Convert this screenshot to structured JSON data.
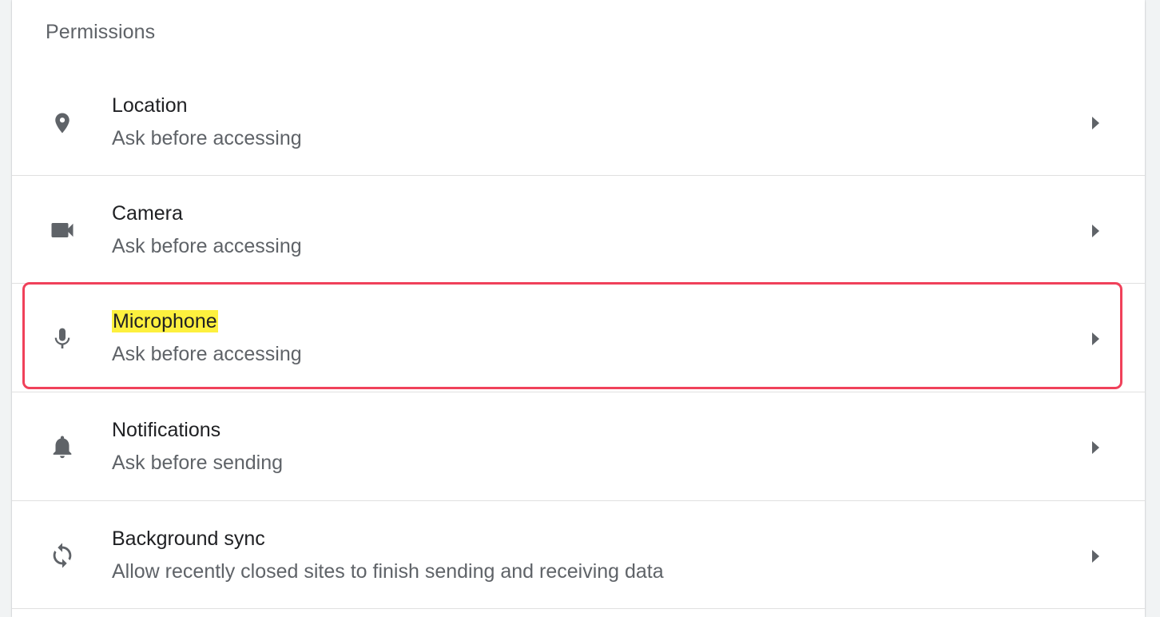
{
  "section": {
    "title": "Permissions"
  },
  "rows": [
    {
      "title": "Location",
      "subtitle": "Ask before accessing",
      "icon": "location-pin-icon"
    },
    {
      "title": "Camera",
      "subtitle": "Ask before accessing",
      "icon": "videocam-icon"
    },
    {
      "title": "Microphone",
      "subtitle": "Ask before accessing",
      "icon": "microphone-icon",
      "highlighted": true
    },
    {
      "title": "Notifications",
      "subtitle": "Ask before sending",
      "icon": "bell-icon"
    },
    {
      "title": "Background sync",
      "subtitle": "Allow recently closed sites to finish sending and receiving data",
      "icon": "sync-icon"
    }
  ],
  "colors": {
    "icon": "#5f6368",
    "title": "#202124",
    "subtitle": "#5f6368",
    "highlight": "#fdf03e",
    "outline": "#f0415a",
    "divider": "#e0e0e0"
  }
}
